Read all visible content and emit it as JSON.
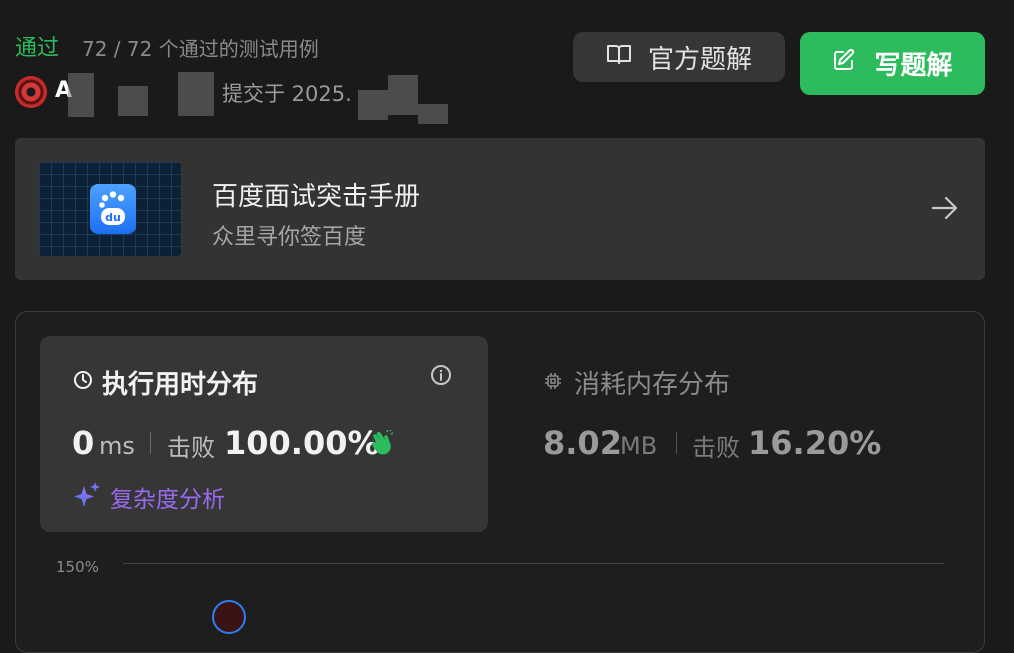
{
  "header": {
    "status": "通过",
    "case_count": "72 / 72 个通过的测试用例",
    "user_initial": "A",
    "submitted_text": "提交于 2025.",
    "official_solution_label": "官方题解",
    "write_solution_label": "写题解"
  },
  "banner": {
    "title": "百度面试突击手册",
    "subtitle": "众里寻你签百度",
    "logo_text": "du"
  },
  "runtime": {
    "title": "执行用时分布",
    "value": "0",
    "unit": "ms",
    "beat_label": "击败",
    "percentile": "100.00%",
    "complexity_label": "复杂度分析"
  },
  "memory": {
    "title": "消耗内存分布",
    "value": "8.02",
    "unit": "MB",
    "beat_label": "击败",
    "percentile": "16.20%"
  },
  "chart": {
    "y_tick": "150%"
  },
  "colors": {
    "accent_green": "#2cbb5d",
    "complexity_purple": "#9a6af0",
    "background": "#1a1a1a"
  }
}
